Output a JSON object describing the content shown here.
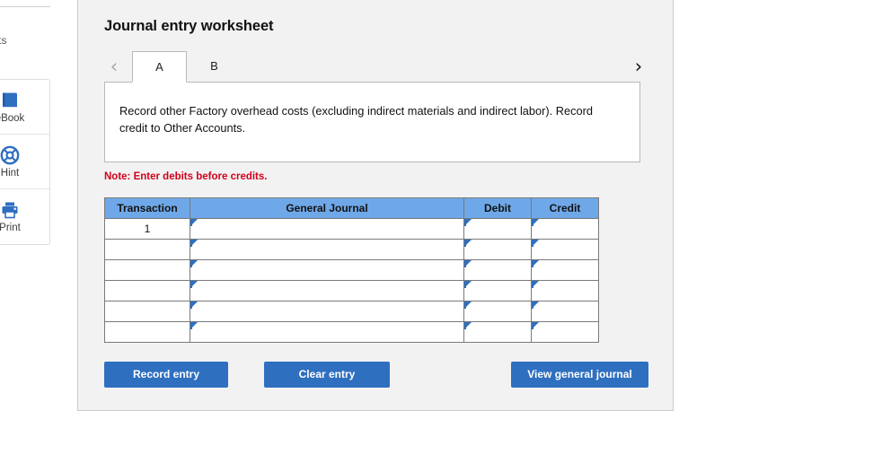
{
  "sidebar": {
    "points_label": "ts",
    "tools": [
      {
        "label": "eBook",
        "icon": "book-icon"
      },
      {
        "label": "Hint",
        "icon": "life-ring-icon"
      },
      {
        "label": "Print",
        "icon": "printer-icon"
      }
    ]
  },
  "panel": {
    "title": "Journal entry worksheet",
    "tabs": [
      {
        "label": "A",
        "active": true
      },
      {
        "label": "B",
        "active": false
      }
    ],
    "nav": {
      "prev_icon": "chevron-left-icon",
      "prev_glyph": "‹",
      "next_icon": "chevron-right-icon",
      "next_glyph": "›"
    },
    "instruction": "Record other Factory overhead costs (excluding indirect materials and indirect labor). Record credit to Other Accounts.",
    "note": "Note: Enter debits before credits.",
    "table": {
      "columns": [
        "Transaction",
        "General Journal",
        "Debit",
        "Credit"
      ],
      "rows": [
        {
          "transaction": "1",
          "general_journal": "",
          "debit": "",
          "credit": ""
        },
        {
          "transaction": "",
          "general_journal": "",
          "debit": "",
          "credit": ""
        },
        {
          "transaction": "",
          "general_journal": "",
          "debit": "",
          "credit": ""
        },
        {
          "transaction": "",
          "general_journal": "",
          "debit": "",
          "credit": ""
        },
        {
          "transaction": "",
          "general_journal": "",
          "debit": "",
          "credit": ""
        },
        {
          "transaction": "",
          "general_journal": "",
          "debit": "",
          "credit": ""
        }
      ]
    },
    "buttons": {
      "record": "Record entry",
      "clear": "Clear entry",
      "view": "View general journal"
    }
  },
  "colors": {
    "header_blue": "#6fa8e8",
    "button_blue": "#2f6fc0",
    "cell_border_blue": "#4a7fbf",
    "note_red": "#d0021b",
    "panel_bg": "#f2f2f2"
  }
}
